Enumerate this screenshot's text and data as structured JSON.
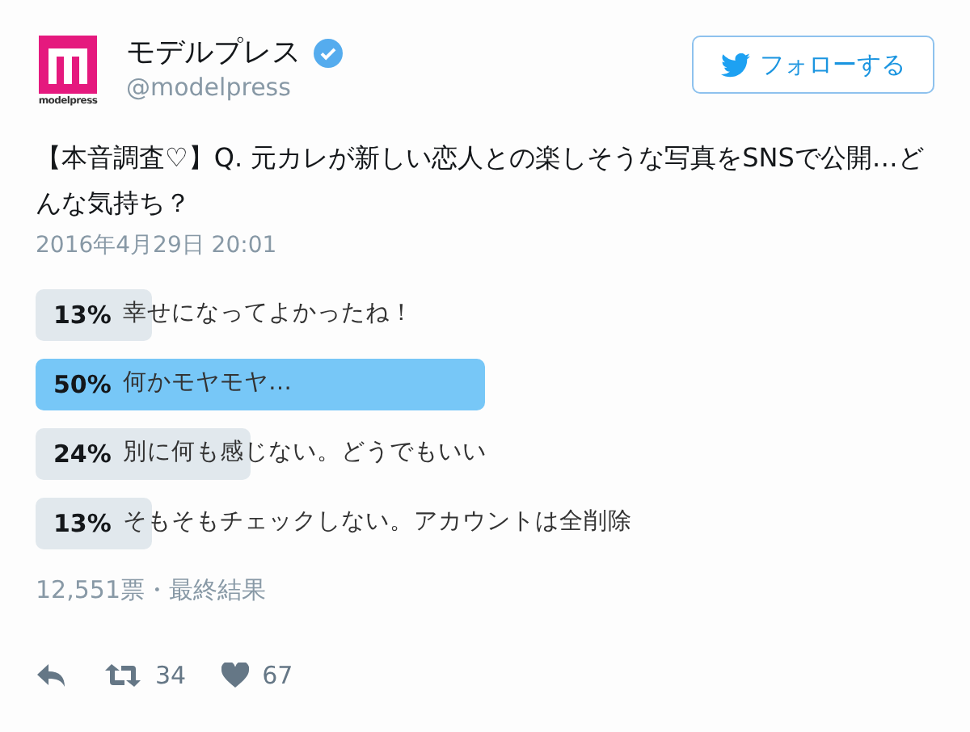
{
  "account": {
    "name": "モデルプレス",
    "verified": true,
    "handle": "@modelpress",
    "logo_text": "modelpress"
  },
  "follow_button": {
    "label": "フォローする"
  },
  "tweet": {
    "text": "【本音調査♡】Q. 元カレが新しい恋人との楽しそうな写真をSNSで公開…どんな気持ち？",
    "date": "2016年4月29日 20:01"
  },
  "poll": {
    "options": [
      {
        "percent": "13%",
        "label": "幸せになってよかったね！",
        "selected": false
      },
      {
        "percent": "50%",
        "label": "何かモヤモヤ…",
        "selected": true
      },
      {
        "percent": "24%",
        "label": "別に何も感じない。どうでもいい",
        "selected": false
      },
      {
        "percent": "13%",
        "label": "そもそもチェックしない。アカウントは全削除",
        "selected": false
      }
    ],
    "summary": "12,551票・最終結果"
  },
  "actions": {
    "retweets": "34",
    "likes": "67"
  }
}
